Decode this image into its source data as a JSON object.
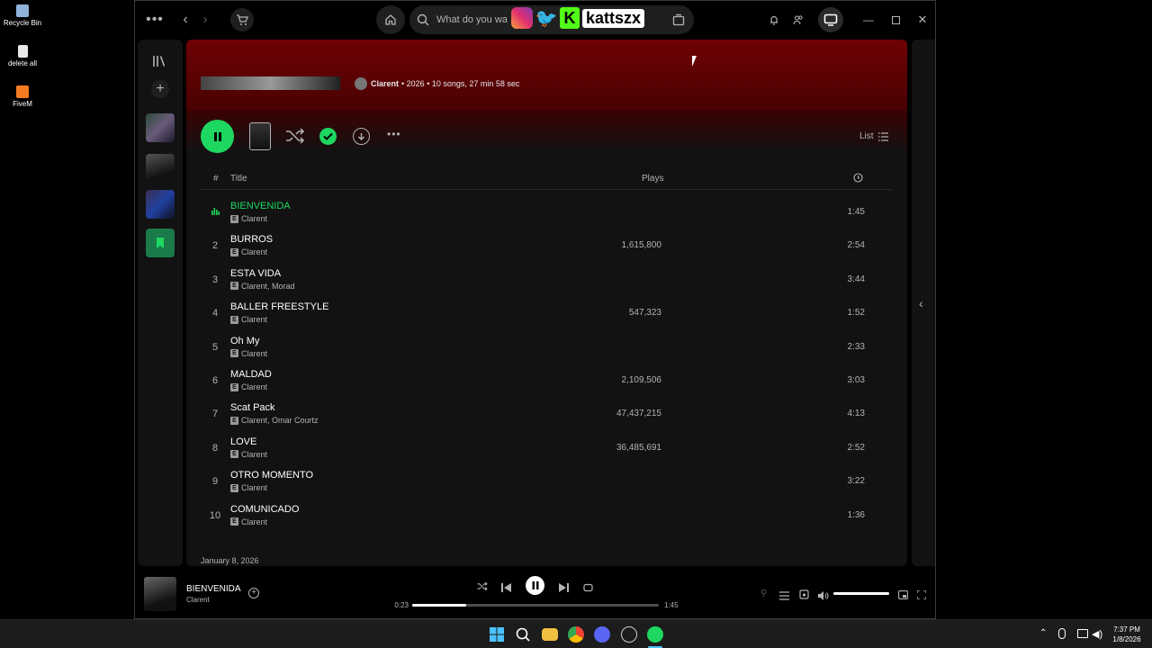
{
  "desktop": {
    "icons": [
      {
        "label": "Recycle Bin",
        "icon": "recycle-bin-icon"
      },
      {
        "label": "delete all",
        "icon": "file-icon"
      },
      {
        "label": "FiveM",
        "icon": "fivem-icon"
      }
    ]
  },
  "titlebar": {
    "search_placeholder": "What do you wa",
    "overlay_handle": "kattszx"
  },
  "album": {
    "artist": "Clarent",
    "meta": "• 2026 • 10 songs, 27 min 58 sec"
  },
  "controls": {
    "view_label": "List"
  },
  "tracklist": {
    "headers": {
      "num": "#",
      "title": "Title",
      "plays": "Plays"
    },
    "tracks": [
      {
        "num": "",
        "title": "BIENVENIDA",
        "artists": "Clarent",
        "plays": "",
        "duration": "1:45",
        "playing": true
      },
      {
        "num": "2",
        "title": "BURROS",
        "artists": "Clarent",
        "plays": "1,615,800",
        "duration": "2:54"
      },
      {
        "num": "3",
        "title": "ESTA VIDA",
        "artists": "Clarent, Morad",
        "plays": "",
        "duration": "3:44"
      },
      {
        "num": "4",
        "title": "BALLER FREESTYLE",
        "artists": "Clarent",
        "plays": "547,323",
        "duration": "1:52"
      },
      {
        "num": "5",
        "title": "Oh My",
        "artists": "Clarent",
        "plays": "",
        "duration": "2:33"
      },
      {
        "num": "6",
        "title": "MALDAD",
        "artists": "Clarent",
        "plays": "2,109,506",
        "duration": "3:03"
      },
      {
        "num": "7",
        "title": "Scat Pack",
        "artists": "Clarent, Omar Courtz",
        "plays": "47,437,215",
        "duration": "4:13"
      },
      {
        "num": "8",
        "title": "LOVE",
        "artists": "Clarent",
        "plays": "36,485,691",
        "duration": "2:52"
      },
      {
        "num": "9",
        "title": "OTRO MOMENTO",
        "artists": "Clarent",
        "plays": "",
        "duration": "3:22"
      },
      {
        "num": "10",
        "title": "COMUNICADO",
        "artists": "Clarent",
        "plays": "",
        "duration": "1:36"
      }
    ],
    "release_date": "January 8, 2026",
    "explicit_label": "E"
  },
  "player": {
    "title": "BIENVENIDA",
    "artist": "Clarent",
    "elapsed": "0:23",
    "total": "1:45",
    "progress": 0.22,
    "volume": 1.0
  },
  "taskbar": {
    "time": "7:37 PM",
    "date": "1/8/2026"
  },
  "colors": {
    "accent": "#1ed760",
    "header": "#6e0204"
  }
}
